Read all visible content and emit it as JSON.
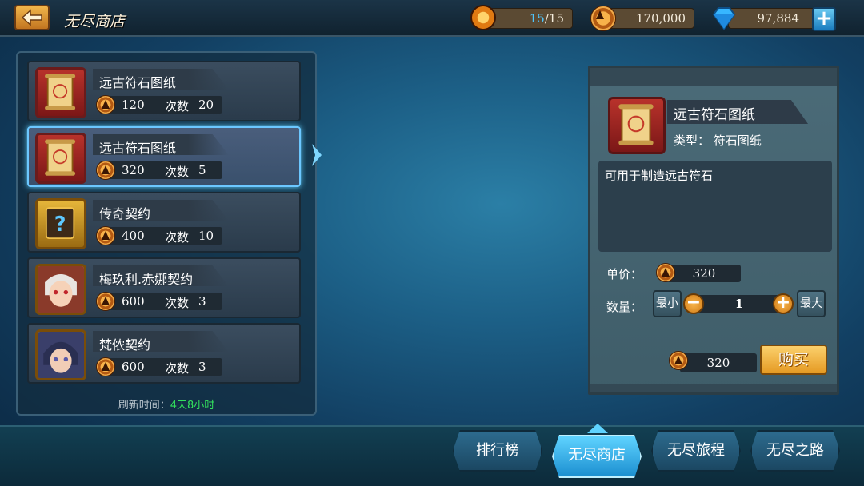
{
  "header": {
    "title": "无尽商店",
    "stamina_current": "15",
    "stamina_max": "/15",
    "gold": "170,000",
    "gems": "97,884"
  },
  "shop": {
    "items": [
      {
        "name": "远古符石图纸",
        "price": "120",
        "count_label": "次数",
        "count": "20",
        "icon": "scroll-icon"
      },
      {
        "name": "远古符石图纸",
        "price": "320",
        "count_label": "次数",
        "count": "5",
        "icon": "scroll-icon"
      },
      {
        "name": "传奇契约",
        "price": "400",
        "count_label": "次数",
        "count": "10",
        "icon": "mystery-contract-icon"
      },
      {
        "name": "梅玖利.赤娜契约",
        "price": "600",
        "count_label": "次数",
        "count": "3",
        "icon": "hero-portrait-icon"
      },
      {
        "name": "梵侬契约",
        "price": "600",
        "count_label": "次数",
        "count": "3",
        "icon": "hero-portrait-icon"
      }
    ],
    "refresh_label": "刷新时间：",
    "refresh_time": "4天8小时"
  },
  "detail": {
    "name": "远古符石图纸",
    "type": "类型：  符石图纸",
    "description": "可用于制造远古符石",
    "unit_price_label": "单价：",
    "unit_price": "320",
    "quantity_label": "数量：",
    "min_label": "最小",
    "max_label": "最大",
    "quantity": "1",
    "total": "320",
    "buy_label": "购买"
  },
  "tabs": [
    "排行榜",
    "无尽商店",
    "无尽旅程",
    "无尽之路"
  ],
  "colors": {
    "accent": "#5fd3ff",
    "refresh_time": "#33e15d",
    "buy": "#f2b54a"
  }
}
